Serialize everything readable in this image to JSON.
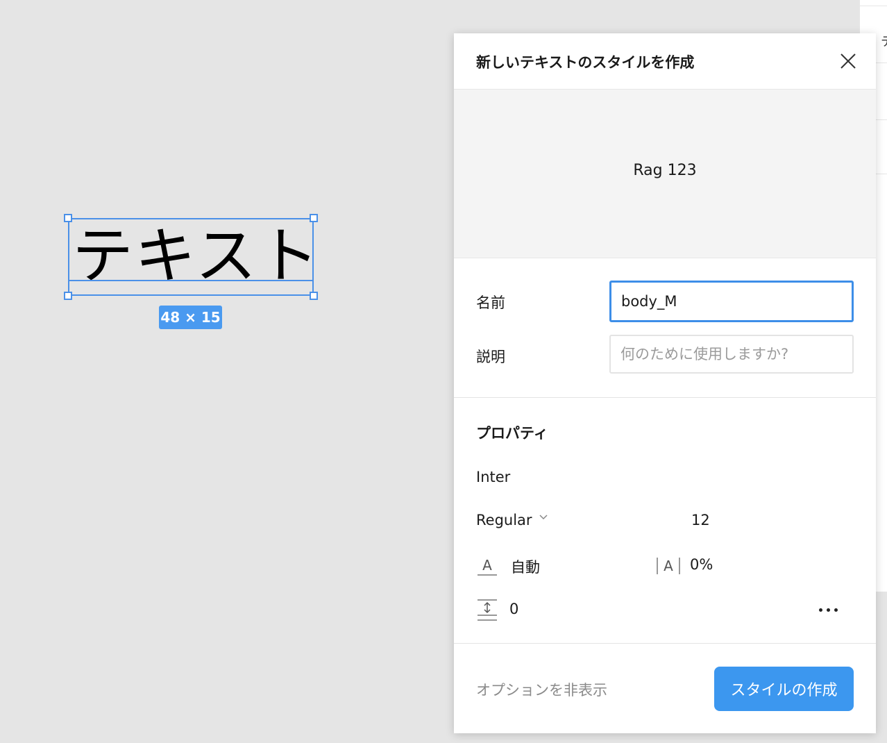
{
  "canvas": {
    "text_layer": "テキスト",
    "size_badge": "48 × 15"
  },
  "side_panel": {
    "edge_glyph": "テ"
  },
  "dialog": {
    "title": "新しいテキストのスタイルを作成",
    "preview_text": "Rag 123",
    "name_label": "名前",
    "name_value": "body_M",
    "description_label": "説明",
    "description_placeholder": "何のために使用しますか?",
    "properties_title": "プロパティ",
    "font_family": "Inter",
    "font_weight": "Regular",
    "font_size": "12",
    "line_height": "自動",
    "letter_spacing": "0%",
    "paragraph_spacing": "0",
    "hide_options_label": "オプションを非表示",
    "create_button_label": "スタイルの作成"
  },
  "colors": {
    "accent": "#3c97ef",
    "selection": "#4a90e8",
    "canvas_bg": "#e5e5e5"
  },
  "icons": [
    "close-icon",
    "chevron-down-icon",
    "line-height-icon",
    "letter-spacing-icon",
    "paragraph-spacing-icon",
    "more-options-icon"
  ]
}
